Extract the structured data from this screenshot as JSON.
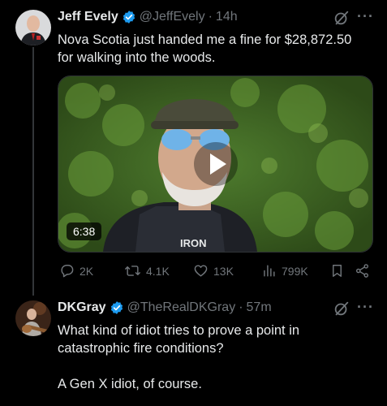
{
  "tweet": {
    "author_name": "Jeff Evely",
    "handle": "@JeffEvely",
    "separator": "·",
    "time": "14h",
    "text_line1": "Nova Scotia just handed me a fine for $28,872.50",
    "text_line2": "for walking into the woods.",
    "more": "···",
    "video_duration": "6:38",
    "stats": {
      "replies": "2K",
      "reposts": "4.1K",
      "likes": "13K",
      "views": "799K"
    }
  },
  "reply": {
    "author_name": "DKGray",
    "handle": "@TheRealDKGray",
    "separator": "·",
    "time": "57m",
    "text_line1": "What kind of idiot tries to prove a point in",
    "text_line2": "catastrophic fire conditions?",
    "text_line3": "A Gen X idiot, of course.",
    "more": "···"
  },
  "colors": {
    "background": "#000000",
    "text_primary": "#e7e9ea",
    "text_secondary": "#71767b",
    "verified_blue": "#1d9bf0"
  }
}
